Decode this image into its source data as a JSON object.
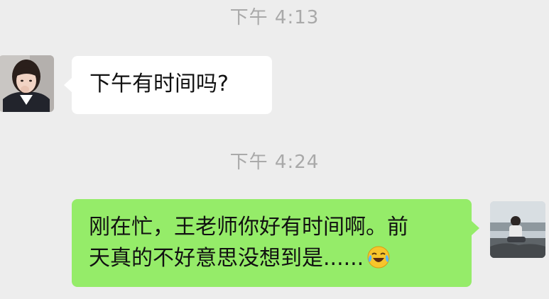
{
  "chat": {
    "messages": [
      {
        "timestamp": "下午 4:13",
        "sender": "other",
        "avatar_icon": "girl-avatar-icon",
        "text": "下午有时间吗?"
      },
      {
        "timestamp": "下午 4:24",
        "sender": "self",
        "avatar_icon": "man-outdoor-avatar-icon",
        "text_lines": [
          "刚在忙，王老师你好有时间啊。前",
          "天真的不好意思没想到是......"
        ],
        "emoji_icon": "laughing-crying-emoji-icon"
      }
    ]
  },
  "colors": {
    "background": "#ededed",
    "incoming_bubble": "#ffffff",
    "outgoing_bubble": "#95ec69",
    "timestamp_text": "#a9a9a9"
  }
}
